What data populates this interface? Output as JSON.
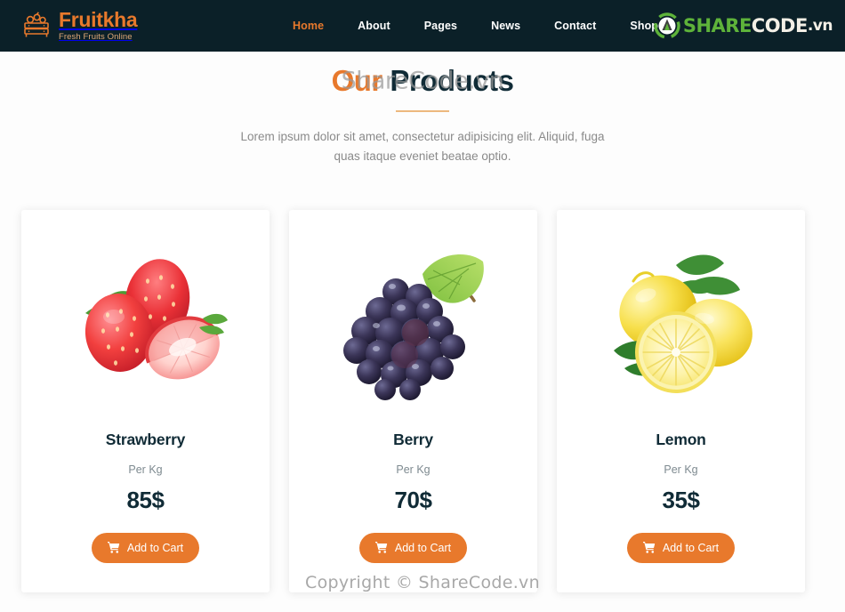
{
  "header": {
    "brand": {
      "name": "Fruitkha",
      "tagline": "Fresh Fruits Online",
      "icon": "fruit-crate-icon"
    },
    "nav": [
      {
        "label": "Home",
        "active": true
      },
      {
        "label": "About",
        "active": false
      },
      {
        "label": "Pages",
        "active": false
      },
      {
        "label": "News",
        "active": false
      },
      {
        "label": "Contact",
        "active": false
      },
      {
        "label": "Shop",
        "active": false
      }
    ],
    "watermark_logo": {
      "share": "SHARE",
      "code": "CODE",
      "tld": ".vn"
    }
  },
  "section": {
    "title_accent": "Our ",
    "title_main": "Products",
    "title_watermark": "ShareCode.vn",
    "subtitle": "Lorem ipsum dolor sit amet, consectetur adipisicing elit. Aliquid, fuga quas itaque eveniet beatae optio."
  },
  "products": [
    {
      "name": "Strawberry",
      "unit": "Per Kg",
      "price": "85$",
      "image": "strawberry-image",
      "button": "Add to Cart"
    },
    {
      "name": "Berry",
      "unit": "Per Kg",
      "price": "70$",
      "image": "grapes-image",
      "button": "Add to Cart"
    },
    {
      "name": "Lemon",
      "unit": "Per Kg",
      "price": "35$",
      "image": "lemon-image",
      "button": "Add to Cart"
    }
  ],
  "footer": {
    "copyright": "Copyright © ShareCode.vn"
  },
  "colors": {
    "header_bg": "#0b2028",
    "accent_orange": "#e8792c",
    "dark_navy": "#102b36",
    "muted_text": "#8a8a8a",
    "watermark_green": "#5eb33a",
    "page_bg": "#fdfdfd"
  }
}
